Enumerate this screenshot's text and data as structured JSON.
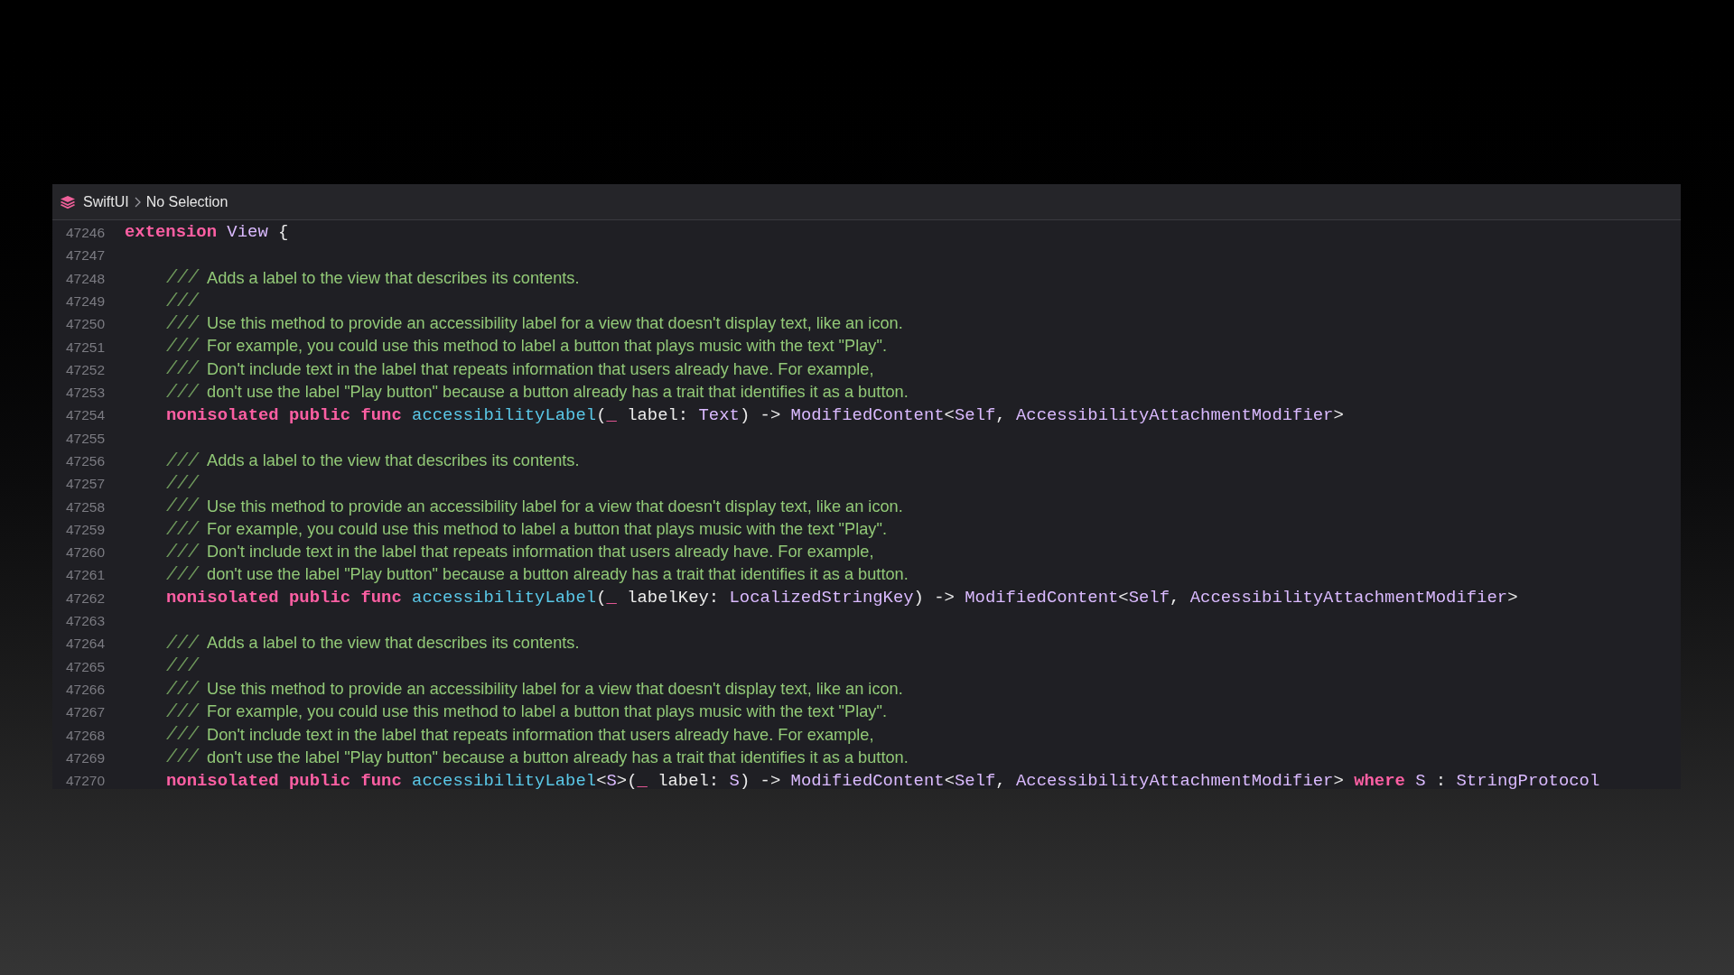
{
  "breadcrumb": [
    "SwiftUI",
    "No Selection"
  ],
  "lines": [
    {
      "number": "47246",
      "kind": "code",
      "tokens": [
        {
          "kind": "keyword",
          "text": "extension"
        },
        {
          "kind": "type",
          "text": " View"
        },
        {
          "kind": "plain",
          "text": " {"
        }
      ],
      "children": [
        {
          "number": "47247",
          "kind": "blank"
        },
        {
          "number": "47248",
          "kind": "doc",
          "marker": "///",
          "text": "Adds a label to the view that describes its contents."
        },
        {
          "number": "47249",
          "kind": "doc",
          "marker": "///"
        },
        {
          "number": "47250",
          "kind": "doc",
          "marker": "///",
          "text": "Use this method to provide an accessibility label for a view that doesn't display text, like an icon."
        },
        {
          "number": "47251",
          "kind": "doc",
          "marker": "///",
          "text": "For example, you could use this method to label a button that plays music with the text \"Play\"."
        },
        {
          "number": "47252",
          "kind": "doc",
          "marker": "///",
          "text": "Don't include text in the label that repeats information that users already have. For example,"
        },
        {
          "number": "47253",
          "kind": "doc",
          "marker": "///",
          "text": "don't use the label \"Play button\" because a button already has a trait that identifies it as a button."
        },
        {
          "number": "47254",
          "kind": "code",
          "tokens": [
            {
              "kind": "keyword",
              "text": "nonisolated public func"
            },
            {
              "kind": "func",
              "text": " accessibilityLabel"
            },
            {
              "kind": "plain",
              "text": "("
            },
            {
              "kind": "keyword",
              "text": "_"
            },
            {
              "kind": "plain",
              "text": " label: "
            },
            {
              "kind": "type",
              "text": "Text"
            },
            {
              "kind": "plain",
              "text": ") -> "
            },
            {
              "kind": "type",
              "text": "ModifiedContent"
            },
            {
              "kind": "plain",
              "text": "<"
            },
            {
              "kind": "type",
              "text": "Self"
            },
            {
              "kind": "plain",
              "text": ", "
            },
            {
              "kind": "type",
              "text": "AccessibilityAttachmentModifier"
            },
            {
              "kind": "plain",
              "text": ">"
            }
          ]
        },
        {
          "number": "47255",
          "kind": "blank"
        },
        {
          "number": "47256",
          "kind": "doc",
          "marker": "///",
          "text": "Adds a label to the view that describes its contents."
        },
        {
          "number": "47257",
          "kind": "doc",
          "marker": "///"
        },
        {
          "number": "47258",
          "kind": "doc",
          "marker": "///",
          "text": "Use this method to provide an accessibility label for a view that doesn't display text, like an icon."
        },
        {
          "number": "47259",
          "kind": "doc",
          "marker": "///",
          "text": "For example, you could use this method to label a button that plays music with the text \"Play\"."
        },
        {
          "number": "47260",
          "kind": "doc",
          "marker": "///",
          "text": "Don't include text in the label that repeats information that users already have. For example,"
        },
        {
          "number": "47261",
          "kind": "doc",
          "marker": "///",
          "text": "don't use the label \"Play button\" because a button already has a trait that identifies it as a button."
        },
        {
          "number": "47262",
          "kind": "code",
          "tokens": [
            {
              "kind": "keyword",
              "text": "nonisolated public func"
            },
            {
              "kind": "func",
              "text": " accessibilityLabel"
            },
            {
              "kind": "plain",
              "text": "("
            },
            {
              "kind": "keyword",
              "text": "_"
            },
            {
              "kind": "plain",
              "text": " labelKey: "
            },
            {
              "kind": "type",
              "text": "LocalizedStringKey"
            },
            {
              "kind": "plain",
              "text": ") -> "
            },
            {
              "kind": "type",
              "text": "ModifiedContent"
            },
            {
              "kind": "plain",
              "text": "<"
            },
            {
              "kind": "type",
              "text": "Self"
            },
            {
              "kind": "plain",
              "text": ", "
            },
            {
              "kind": "type",
              "text": "AccessibilityAttachmentModifier"
            },
            {
              "kind": "plain",
              "text": ">"
            }
          ]
        },
        {
          "number": "47263",
          "kind": "blank"
        },
        {
          "number": "47264",
          "kind": "doc",
          "marker": "///",
          "text": "Adds a label to the view that describes its contents."
        },
        {
          "number": "47265",
          "kind": "doc",
          "marker": "///"
        },
        {
          "number": "47266",
          "kind": "doc",
          "marker": "///",
          "text": "Use this method to provide an accessibility label for a view that doesn't display text, like an icon."
        },
        {
          "number": "47267",
          "kind": "doc",
          "marker": "///",
          "text": "For example, you could use this method to label a button that plays music with the text \"Play\"."
        },
        {
          "number": "47268",
          "kind": "doc",
          "marker": "///",
          "text": "Don't include text in the label that repeats information that users already have. For example,"
        },
        {
          "number": "47269",
          "kind": "doc",
          "marker": "///",
          "text": "don't use the label \"Play button\" because a button already has a trait that identifies it as a button."
        },
        {
          "number": "47270",
          "kind": "code",
          "tokens": [
            {
              "kind": "keyword",
              "text": "nonisolated public func"
            },
            {
              "kind": "func",
              "text": " accessibilityLabel"
            },
            {
              "kind": "plain",
              "text": "<"
            },
            {
              "kind": "type",
              "text": "S"
            },
            {
              "kind": "plain",
              "text": ">("
            },
            {
              "kind": "keyword",
              "text": "_"
            },
            {
              "kind": "plain",
              "text": " label: "
            },
            {
              "kind": "type",
              "text": "S"
            },
            {
              "kind": "plain",
              "text": ") -> "
            },
            {
              "kind": "type",
              "text": "ModifiedContent"
            },
            {
              "kind": "plain",
              "text": "<"
            },
            {
              "kind": "type",
              "text": "Self"
            },
            {
              "kind": "plain",
              "text": ", "
            },
            {
              "kind": "type",
              "text": "AccessibilityAttachmentModifier"
            },
            {
              "kind": "plain",
              "text": "> "
            },
            {
              "kind": "keyword",
              "text": "where"
            },
            {
              "kind": "type",
              "text": " S"
            },
            {
              "kind": "plain",
              "text": " : "
            },
            {
              "kind": "type",
              "text": "StringProtocol"
            }
          ]
        }
      ]
    }
  ]
}
